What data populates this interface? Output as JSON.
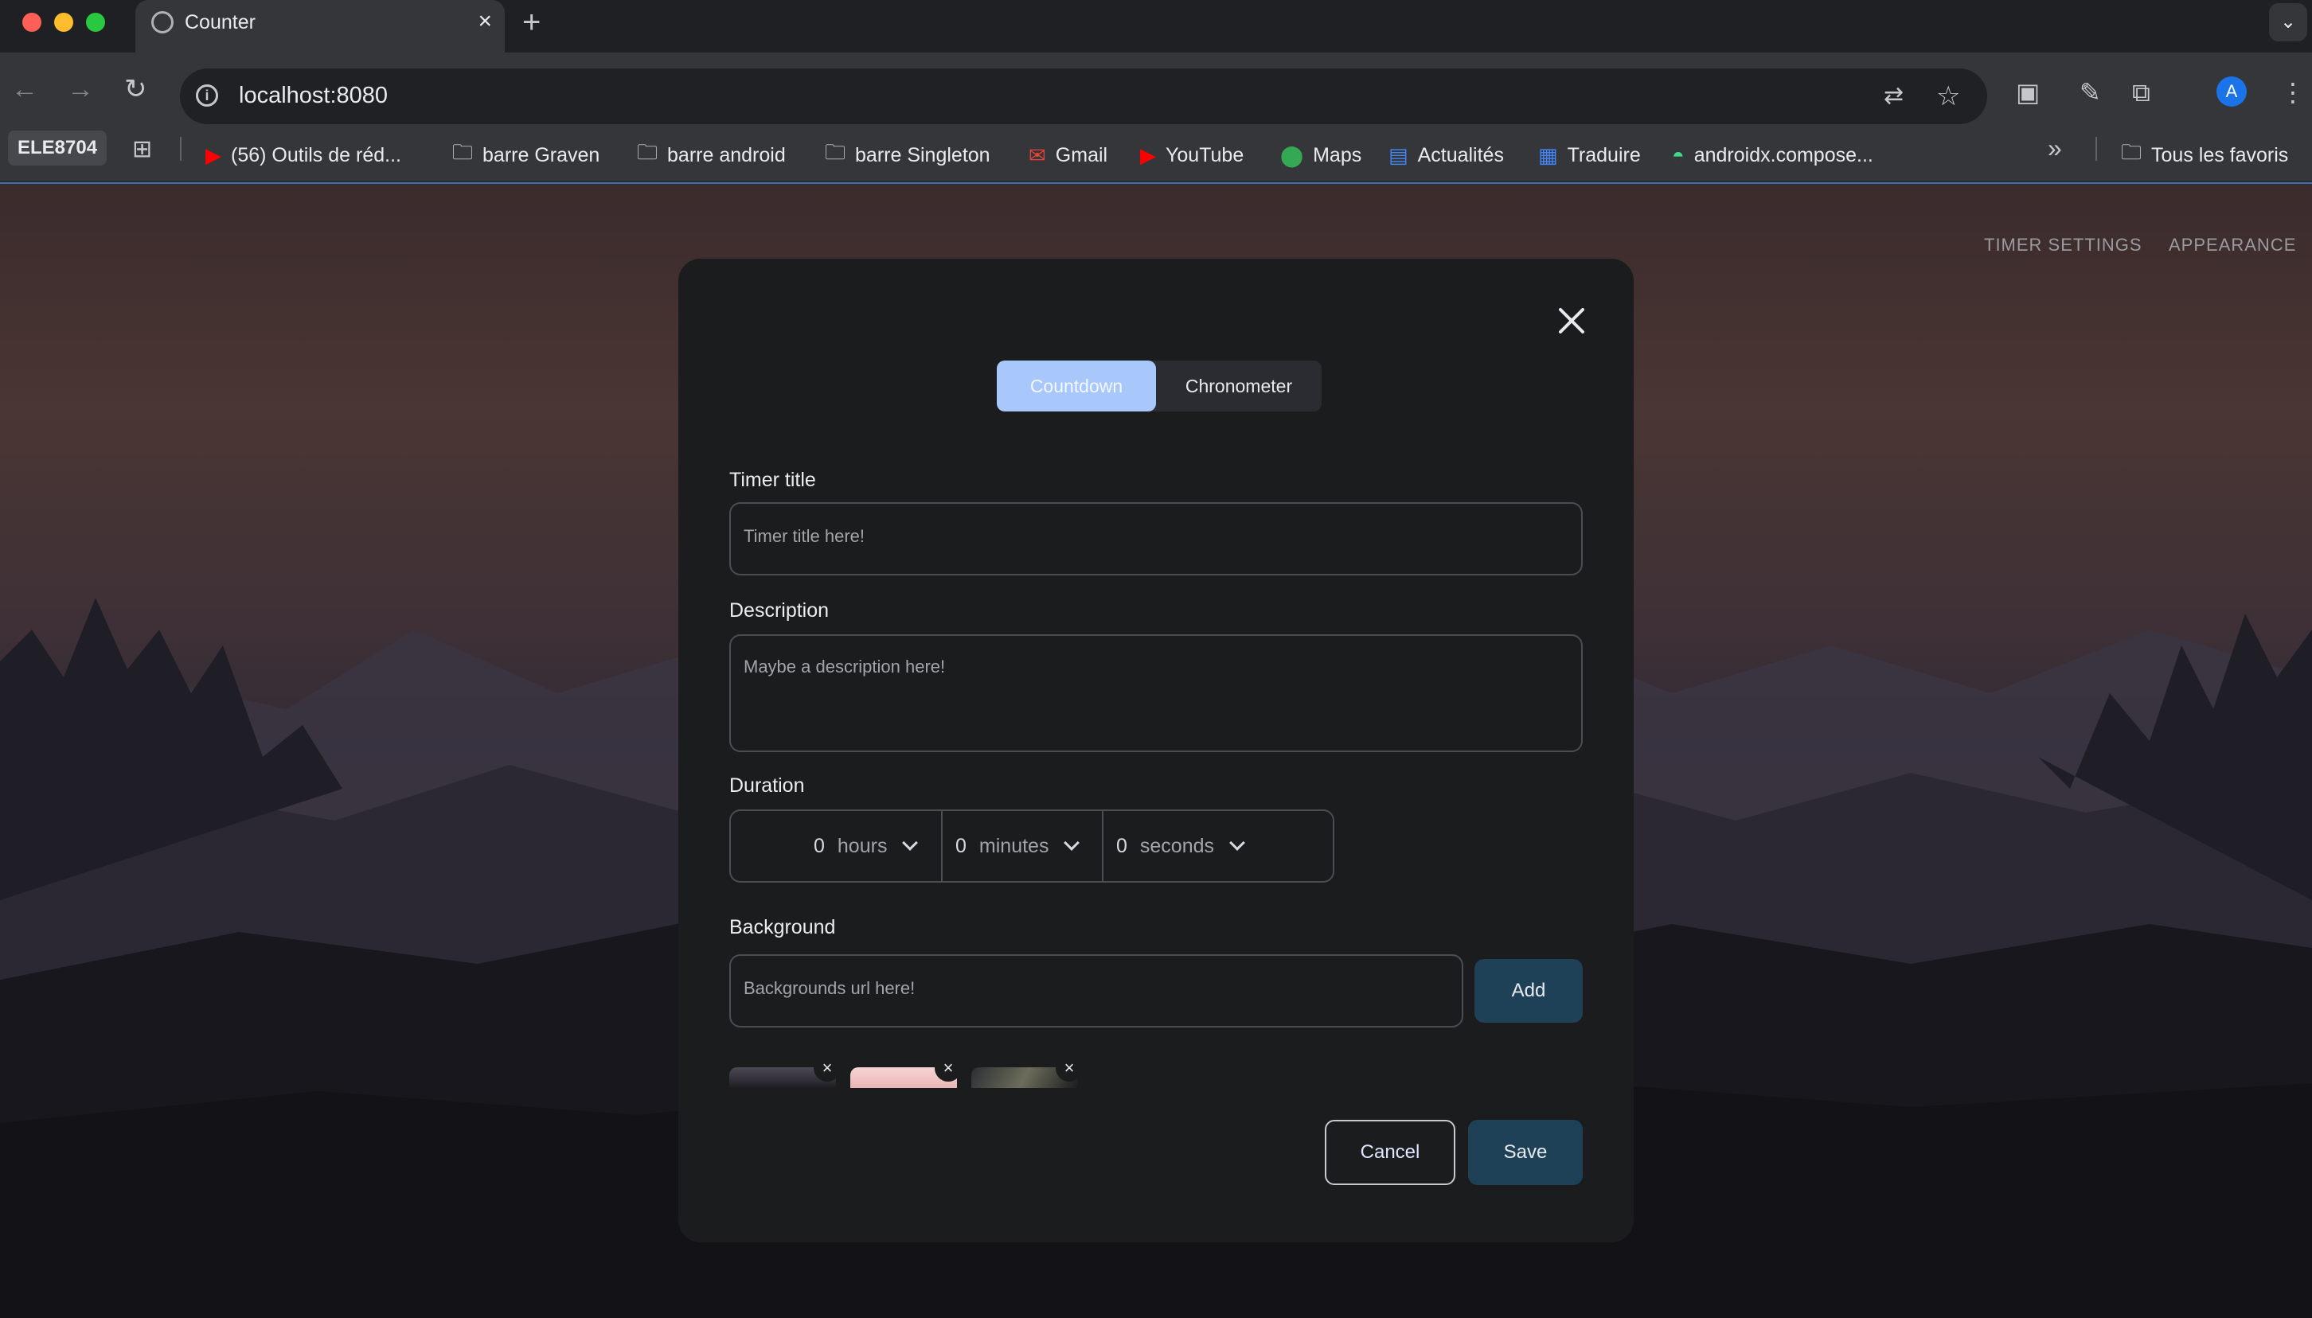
{
  "browser": {
    "tab_title": "Counter",
    "url": "localhost:8080",
    "profile_initial": "A",
    "bookmarks_profile": "ELE8704",
    "bookmarks": [
      {
        "label": "(56) Outils de réd...",
        "icon": "youtube-icon"
      },
      {
        "label": "barre Graven",
        "icon": "folder-icon"
      },
      {
        "label": "barre android",
        "icon": "folder-icon"
      },
      {
        "label": "barre Singleton",
        "icon": "folder-icon"
      },
      {
        "label": "Gmail",
        "icon": "gmail-icon"
      },
      {
        "label": "YouTube",
        "icon": "youtube-icon"
      },
      {
        "label": "Maps",
        "icon": "maps-icon"
      },
      {
        "label": "Actualités",
        "icon": "news-icon"
      },
      {
        "label": "Traduire",
        "icon": "translate-icon"
      },
      {
        "label": "androidx.compose...",
        "icon": "android-icon"
      }
    ],
    "all_bookmarks": "Tous les favoris"
  },
  "nav": {
    "timer_settings": "TIMER SETTINGS",
    "appearance": "APPEARANCE"
  },
  "modal": {
    "mode_tabs": [
      "Countdown",
      "Chronometer"
    ],
    "active_mode": "Countdown",
    "timer_title_label": "Timer title",
    "timer_title_placeholder": "Timer title here!",
    "description_label": "Description",
    "description_placeholder": "Maybe a description here!",
    "duration_label": "Duration",
    "duration": {
      "hours": {
        "value": "0",
        "unit": "hours"
      },
      "minutes": {
        "value": "0",
        "unit": "minutes"
      },
      "seconds": {
        "value": "0",
        "unit": "seconds"
      }
    },
    "background_label": "Background",
    "background_placeholder": "Backgrounds url here!",
    "add_label": "Add",
    "thumbnail_remove": "×",
    "cancel_label": "Cancel",
    "save_label": "Save"
  },
  "colors": {
    "accent_selected": "#a8c7fa",
    "primary_button": "#1e4158",
    "modal_bg": "#1b1c1e"
  }
}
